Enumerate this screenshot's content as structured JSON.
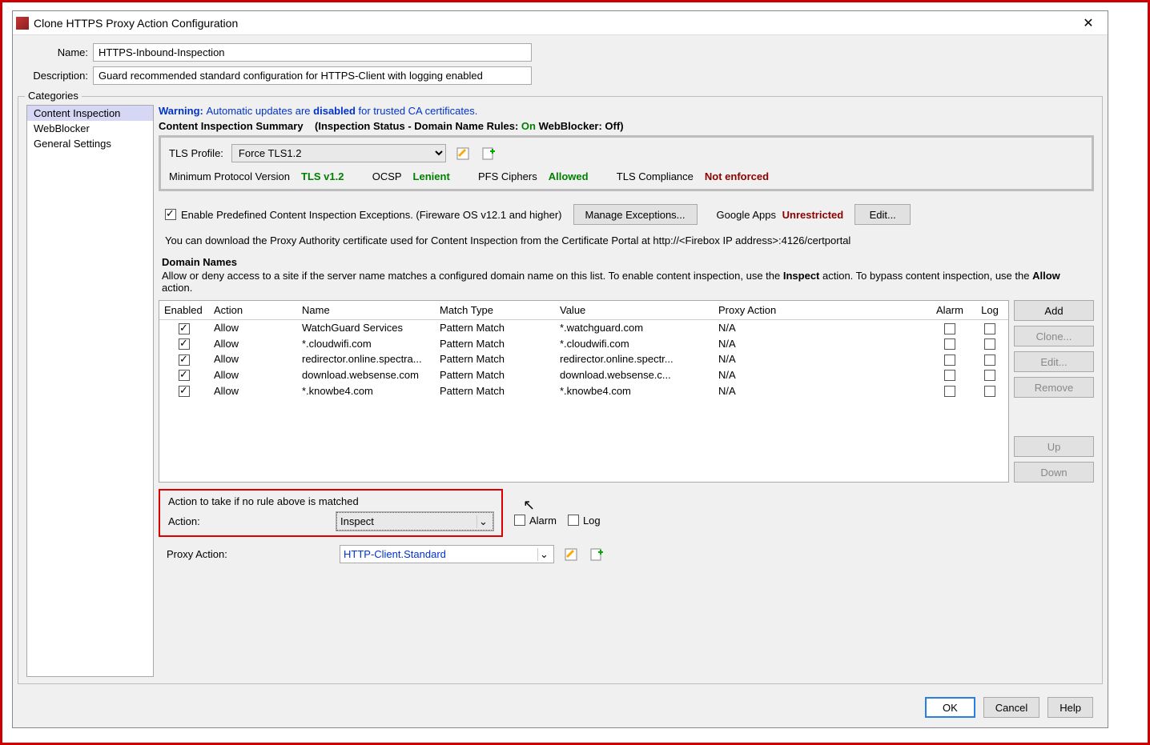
{
  "window": {
    "title": "Clone HTTPS Proxy Action Configuration",
    "close_glyph": "✕"
  },
  "form": {
    "name_label": "Name:",
    "name_value": "HTTPS-Inbound-Inspection",
    "desc_label": "Description:",
    "desc_value": "Guard recommended standard configuration for HTTPS-Client with logging enabled"
  },
  "categories": {
    "legend": "Categories",
    "items": [
      "Content Inspection",
      "WebBlocker",
      "General Settings"
    ],
    "selected_index": 0
  },
  "warning": {
    "prefix": "Warning: ",
    "mid1": "Automatic updates are ",
    "bold": "disabled",
    "mid2": " for trusted CA certificates."
  },
  "summary": {
    "label": "Content Inspection Summary",
    "status_lead": "(Inspection Status  -  Domain Name Rules: ",
    "on": "On",
    "web_lead": "  WebBlocker: ",
    "off": "Off",
    "close": ")"
  },
  "tls": {
    "profile_label": "TLS Profile:",
    "profile_value": "Force TLS1.2",
    "min_label": "Minimum Protocol Version",
    "min_value": "TLS v1.2",
    "ocsp_label": "OCSP",
    "ocsp_value": "Lenient",
    "pfs_label": "PFS Ciphers",
    "pfs_value": "Allowed",
    "comp_label": "TLS Compliance",
    "comp_value": "Not enforced"
  },
  "exceptions": {
    "checkbox_label": "Enable Predefined Content Inspection Exceptions. (Fireware OS v12.1 and higher)",
    "manage_btn": "Manage Exceptions...",
    "google_label": "Google Apps",
    "google_value": "Unrestricted",
    "edit_btn": "Edit..."
  },
  "cert_info": "You can download the Proxy Authority certificate used for Content Inspection from the Certificate Portal at http://<Firebox IP address>:4126/certportal",
  "domain": {
    "heading": "Domain Names",
    "desc_a": "Allow or deny access to a site if the server name matches a configured domain name on this list. To enable content inspection, use the ",
    "desc_b": "Inspect",
    "desc_c": " action. To bypass content inspection, use the ",
    "desc_d": "Allow",
    "desc_e": " action."
  },
  "columns": {
    "enabled": "Enabled",
    "action": "Action",
    "name": "Name",
    "match": "Match Type",
    "value": "Value",
    "proxy": "Proxy Action",
    "alarm": "Alarm",
    "log": "Log"
  },
  "rows": [
    {
      "enabled": true,
      "action": "Allow",
      "name": "WatchGuard Services",
      "match": "Pattern Match",
      "value": "*.watchguard.com",
      "proxy": "N/A",
      "alarm": false,
      "log": false
    },
    {
      "enabled": true,
      "action": "Allow",
      "name": "*.cloudwifi.com",
      "match": "Pattern Match",
      "value": "*.cloudwifi.com",
      "proxy": "N/A",
      "alarm": false,
      "log": false
    },
    {
      "enabled": true,
      "action": "Allow",
      "name": "redirector.online.spectra...",
      "match": "Pattern Match",
      "value": "redirector.online.spectr...",
      "proxy": "N/A",
      "alarm": false,
      "log": false
    },
    {
      "enabled": true,
      "action": "Allow",
      "name": "download.websense.com",
      "match": "Pattern Match",
      "value": "download.websense.c...",
      "proxy": "N/A",
      "alarm": false,
      "log": false
    },
    {
      "enabled": true,
      "action": "Allow",
      "name": "*.knowbe4.com",
      "match": "Pattern Match",
      "value": "*.knowbe4.com",
      "proxy": "N/A",
      "alarm": false,
      "log": false
    }
  ],
  "sidebuttons": {
    "add": "Add",
    "clone": "Clone...",
    "edit": "Edit...",
    "remove": "Remove",
    "up": "Up",
    "down": "Down"
  },
  "default_action": {
    "heading": "Action to take if no rule above is matched",
    "action_label": "Action:",
    "action_value": "Inspect",
    "alarm_label": "Alarm",
    "log_label": "Log"
  },
  "proxy_action": {
    "label": "Proxy Action:",
    "value": "HTTP-Client.Standard"
  },
  "footer": {
    "ok": "OK",
    "cancel": "Cancel",
    "help": "Help"
  },
  "glyphs": {
    "caret": "⌄",
    "edit_icon": "✎",
    "new_icon": "📄"
  }
}
